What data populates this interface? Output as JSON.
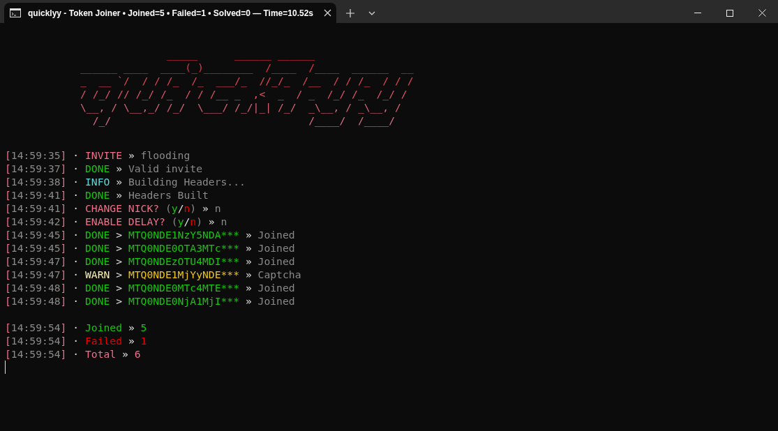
{
  "window": {
    "tab_title": "quicklyy - Token Joiner • Joined=5 • Failed=1 • Solved=0 — Time=10.52s"
  },
  "logo": [
    "              _____      ______ ______",
    "______ ____  ____(_)________  /____  /____  ______  __",
    "_  __ `/  / / /_  /_  ___/_  //_/_  /__  / / /_  / / /",
    "/ /_/ // /_/ /_  / / /__ _  ,<  _  / _  /_/ /_  /_/ /",
    "\\__, / \\__,_/ /_/  \\___/ /_/|_| /_/  _\\__, / _\\__, /",
    "  /_/                                /____/  /____/"
  ],
  "log_lines": [
    {
      "time": "[14:59:35]",
      "parts": [
        {
          "kind": "dot",
          "text": "·"
        },
        {
          "kind": "tag-pink",
          "text": "INVITE"
        },
        {
          "kind": "arrow",
          "text": "»"
        },
        {
          "kind": "message",
          "text": "flooding"
        }
      ]
    },
    {
      "time": "[14:59:37]",
      "parts": [
        {
          "kind": "dot",
          "text": "·"
        },
        {
          "kind": "tag-green",
          "text": "DONE"
        },
        {
          "kind": "arrow",
          "text": "»"
        },
        {
          "kind": "message",
          "text": "Valid invite"
        }
      ]
    },
    {
      "time": "[14:59:38]",
      "parts": [
        {
          "kind": "dot",
          "text": "·"
        },
        {
          "kind": "tag-cyan",
          "text": "INFO"
        },
        {
          "kind": "arrow",
          "text": "»"
        },
        {
          "kind": "message",
          "text": "Building Headers..."
        }
      ]
    },
    {
      "time": "[14:59:41]",
      "parts": [
        {
          "kind": "dot",
          "text": "·"
        },
        {
          "kind": "tag-green",
          "text": "DONE"
        },
        {
          "kind": "arrow",
          "text": "»"
        },
        {
          "kind": "message",
          "text": "Headers Built"
        }
      ]
    },
    {
      "time": "[14:59:41]",
      "parts": [
        {
          "kind": "dot",
          "text": "·"
        },
        {
          "kind": "tag-pink",
          "text": "CHANGE NICK?"
        },
        {
          "kind": "prompt",
          "text": "(y/n)"
        },
        {
          "kind": "arrow",
          "text": "»"
        },
        {
          "kind": "message",
          "text": "n"
        }
      ]
    },
    {
      "time": "[14:59:42]",
      "parts": [
        {
          "kind": "dot",
          "text": "·"
        },
        {
          "kind": "tag-pink",
          "text": "ENABLE DELAY?"
        },
        {
          "kind": "prompt",
          "text": "(y/n)"
        },
        {
          "kind": "arrow",
          "text": "»"
        },
        {
          "kind": "message",
          "text": "n"
        }
      ]
    },
    {
      "time": "[14:59:45]",
      "parts": [
        {
          "kind": "dot",
          "text": "·"
        },
        {
          "kind": "tag-green",
          "text": "DONE"
        },
        {
          "kind": "arrow",
          "text": ">"
        },
        {
          "kind": "token-green",
          "text": "MTQ0NDE1NzY5NDA***"
        },
        {
          "kind": "arrow",
          "text": "»"
        },
        {
          "kind": "message",
          "text": "Joined"
        }
      ]
    },
    {
      "time": "[14:59:45]",
      "parts": [
        {
          "kind": "dot",
          "text": "·"
        },
        {
          "kind": "tag-green",
          "text": "DONE"
        },
        {
          "kind": "arrow",
          "text": ">"
        },
        {
          "kind": "token-green",
          "text": "MTQ0NDE0OTA3MTc***"
        },
        {
          "kind": "arrow",
          "text": "»"
        },
        {
          "kind": "message",
          "text": "Joined"
        }
      ]
    },
    {
      "time": "[14:59:47]",
      "parts": [
        {
          "kind": "dot",
          "text": "·"
        },
        {
          "kind": "tag-green",
          "text": "DONE"
        },
        {
          "kind": "arrow",
          "text": ">"
        },
        {
          "kind": "token-green",
          "text": "MTQ0NDEzOTU4MDI***"
        },
        {
          "kind": "arrow",
          "text": "»"
        },
        {
          "kind": "message",
          "text": "Joined"
        }
      ]
    },
    {
      "time": "[14:59:47]",
      "parts": [
        {
          "kind": "dot",
          "text": "·"
        },
        {
          "kind": "tag-yellow",
          "text": "WARN"
        },
        {
          "kind": "arrow",
          "text": ">"
        },
        {
          "kind": "token-yellow",
          "text": "MTQ0NDE1MjYyNDE***"
        },
        {
          "kind": "arrow",
          "text": "»"
        },
        {
          "kind": "message",
          "text": "Captcha"
        }
      ]
    },
    {
      "time": "[14:59:48]",
      "parts": [
        {
          "kind": "dot",
          "text": "·"
        },
        {
          "kind": "tag-green",
          "text": "DONE"
        },
        {
          "kind": "arrow",
          "text": ">"
        },
        {
          "kind": "token-green",
          "text": "MTQ0NDE0MTc4MTE***"
        },
        {
          "kind": "arrow",
          "text": "»"
        },
        {
          "kind": "message",
          "text": "Joined"
        }
      ]
    },
    {
      "time": "[14:59:48]",
      "parts": [
        {
          "kind": "dot",
          "text": "·"
        },
        {
          "kind": "tag-green",
          "text": "DONE"
        },
        {
          "kind": "arrow",
          "text": ">"
        },
        {
          "kind": "token-green",
          "text": "MTQ0NDE0NjA1MjI***"
        },
        {
          "kind": "arrow",
          "text": "»"
        },
        {
          "kind": "message",
          "text": "Joined"
        }
      ]
    }
  ],
  "summary_lines": [
    {
      "time": "[14:59:54]",
      "parts": [
        {
          "kind": "dot",
          "text": "·"
        },
        {
          "kind": "tag-green",
          "text": "Joined"
        },
        {
          "kind": "arrow",
          "text": "»"
        },
        {
          "kind": "value-green",
          "text": "5"
        }
      ]
    },
    {
      "time": "[14:59:54]",
      "parts": [
        {
          "kind": "dot",
          "text": "·"
        },
        {
          "kind": "tag-red",
          "text": "Failed"
        },
        {
          "kind": "arrow",
          "text": "»"
        },
        {
          "kind": "value-red",
          "text": "1"
        }
      ]
    },
    {
      "time": "[14:59:54]",
      "parts": [
        {
          "kind": "dot",
          "text": "·"
        },
        {
          "kind": "tag-pink",
          "text": "Total"
        },
        {
          "kind": "arrow",
          "text": "»"
        },
        {
          "kind": "value-pink",
          "text": "6"
        }
      ]
    }
  ]
}
